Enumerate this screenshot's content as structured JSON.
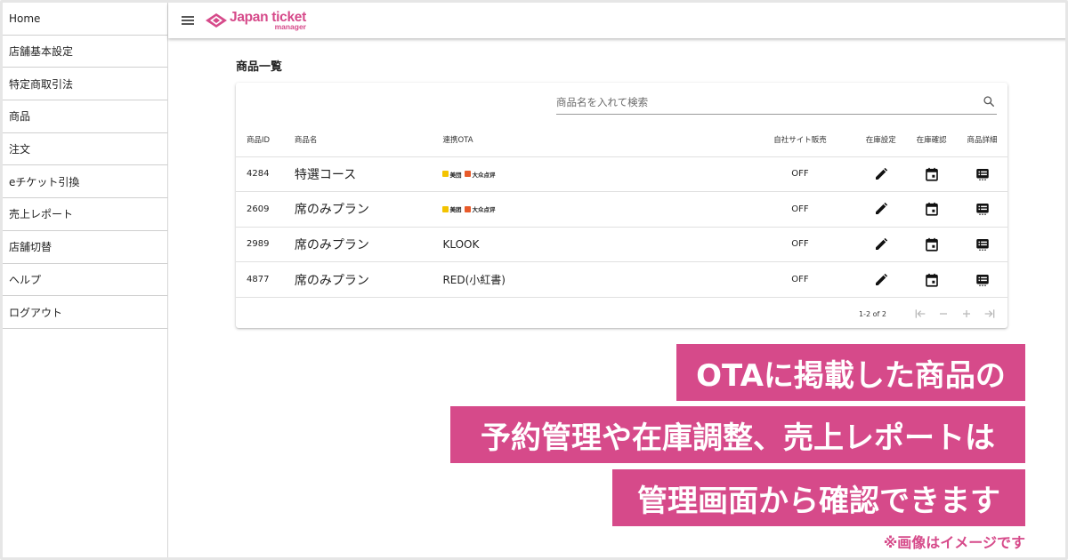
{
  "brand": {
    "logo_main": "Japan ticket",
    "logo_sub": "manager",
    "color": "#d64a8a"
  },
  "sidebar": {
    "items": [
      {
        "label": "Home"
      },
      {
        "label": "店舗基本設定"
      },
      {
        "label": "特定商取引法"
      },
      {
        "label": "商品"
      },
      {
        "label": "注文"
      },
      {
        "label": "eチケット引換"
      },
      {
        "label": "売上レポート"
      },
      {
        "label": "店舗切替"
      },
      {
        "label": "ヘルプ"
      },
      {
        "label": "ログアウト"
      }
    ]
  },
  "main": {
    "title": "商品一覧",
    "search_placeholder": "商品名を入れて検索",
    "columns": {
      "id": "商品ID",
      "name": "商品名",
      "ota": "連携OTA",
      "own_sales": "自社サイト販売",
      "stock_setting": "在庫設定",
      "stock_check": "在庫確認",
      "detail": "商品詳細"
    },
    "rows": [
      {
        "id": "4284",
        "name": "特選コース",
        "ota": "",
        "own_sales": "OFF",
        "ota_logos": [
          "美団",
          "大众点评"
        ]
      },
      {
        "id": "2609",
        "name": "席のみプラン",
        "ota": "",
        "own_sales": "OFF",
        "ota_logos": [
          "美团",
          "大众点评"
        ]
      },
      {
        "id": "2989",
        "name": "席のみプラン",
        "ota": "KLOOK",
        "own_sales": "OFF",
        "ota_logos": []
      },
      {
        "id": "4877",
        "name": "席のみプラン",
        "ota": "RED(小紅書)",
        "own_sales": "OFF",
        "ota_logos": []
      }
    ],
    "pagination": "1-2 of 2"
  },
  "banner": {
    "line1": "OTAに掲載した商品の",
    "line2": "予約管理や在庫調整、売上レポートは",
    "line3": "管理画面から確認できます",
    "note": "※画像はイメージです"
  },
  "icons": [
    "menu-icon",
    "search-icon",
    "edit-icon",
    "calendar-icon",
    "detail-icon",
    "first-page-icon",
    "prev-page-icon",
    "next-page-icon",
    "last-page-icon"
  ]
}
